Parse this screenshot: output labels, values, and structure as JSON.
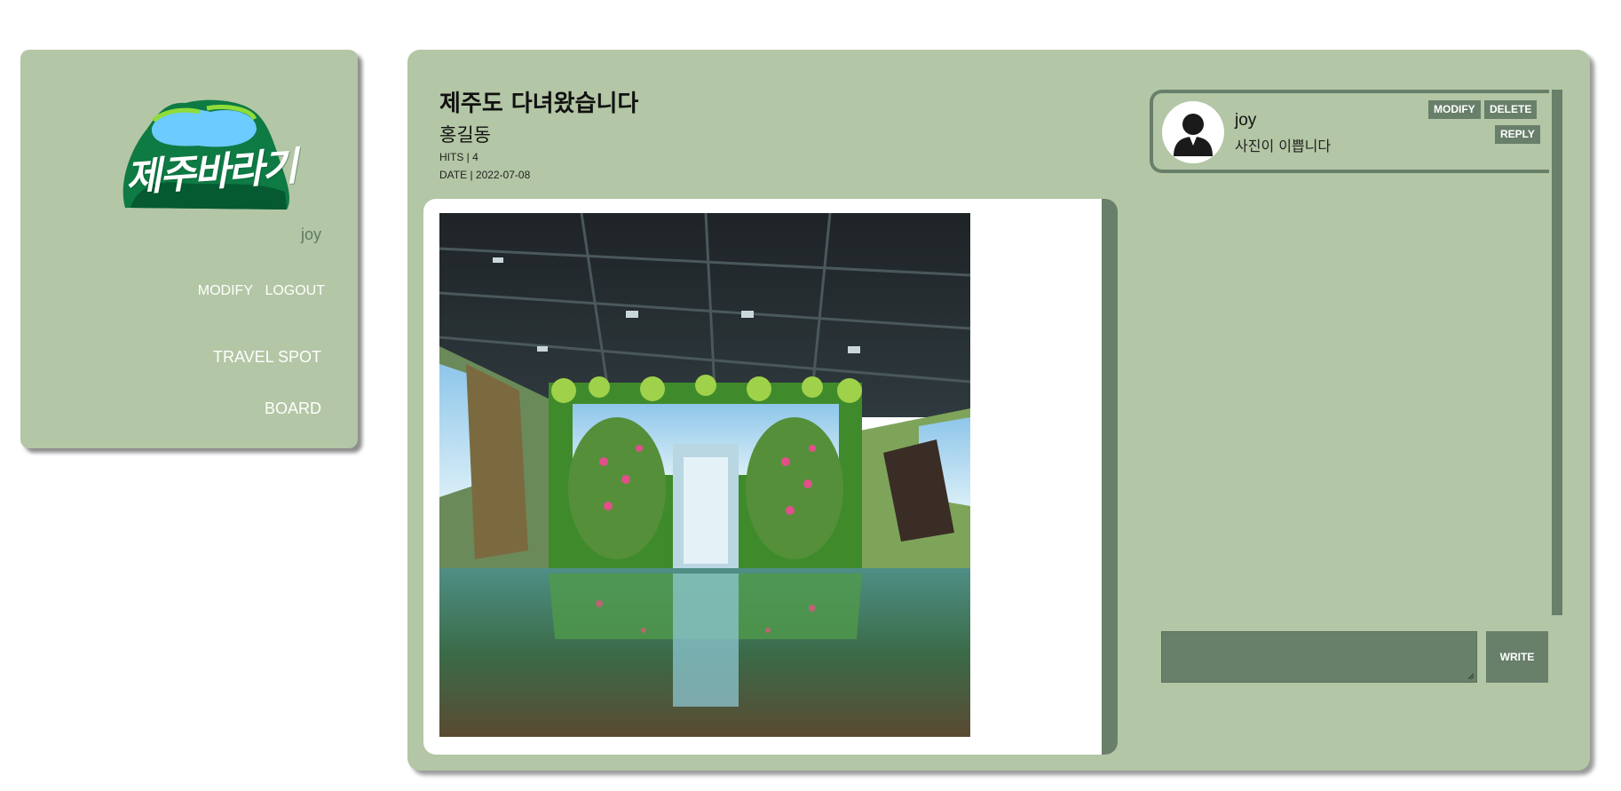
{
  "sidebar": {
    "logo_text": "제주바라기",
    "username": "joy",
    "modify_label": "MODIFY",
    "logout_label": "LOGOUT",
    "travel_spot_label": "TRAVEL SPOT",
    "board_label": "BOARD"
  },
  "post": {
    "title": "제주도 다녀왔습니다",
    "author": "홍길동",
    "hits": "HITS | 4",
    "date": "DATE | 2022-07-08"
  },
  "comments": [
    {
      "user": "joy",
      "text": "사진이 이쁩니다",
      "modify_label": "MODIFY",
      "delete_label": "DELETE",
      "reply_label": "REPLY"
    }
  ],
  "comment_form": {
    "input_value": "",
    "write_label": "WRITE"
  },
  "colors": {
    "panel_bg": "#b3c6a5",
    "accent_dark": "#687f6a",
    "text_muted": "#607a62"
  }
}
